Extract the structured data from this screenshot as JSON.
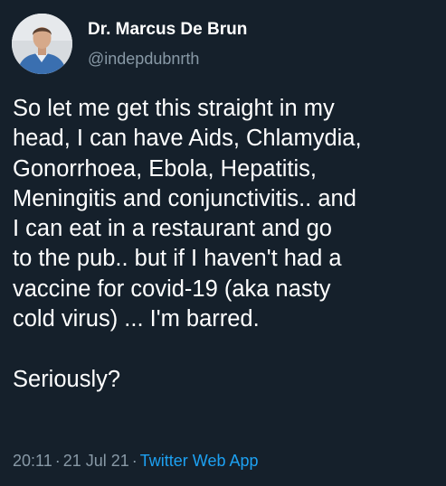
{
  "author": {
    "display_name": "Dr. Marcus De Brun",
    "handle": "@indepdubnrth"
  },
  "tweet": {
    "lines": [
      "So let me get this straight in my",
      "head, I can have Aids, Chlamydia,",
      "Gonorrhoea, Ebola, Hepatitis,",
      "Meningitis and conjunctivitis.. and",
      "I can eat in a restaurant and go",
      "to the pub.. but if I haven't had a",
      "vaccine for covid-19 (aka nasty",
      "cold virus) ... I'm barred.",
      "Seriously?"
    ],
    "time": "20:11",
    "date": "21 Jul 21",
    "separator": "·",
    "source": "Twitter Web App"
  },
  "colors": {
    "background": "#15202b",
    "secondary_text": "#8899a6",
    "link": "#1da1f2"
  }
}
